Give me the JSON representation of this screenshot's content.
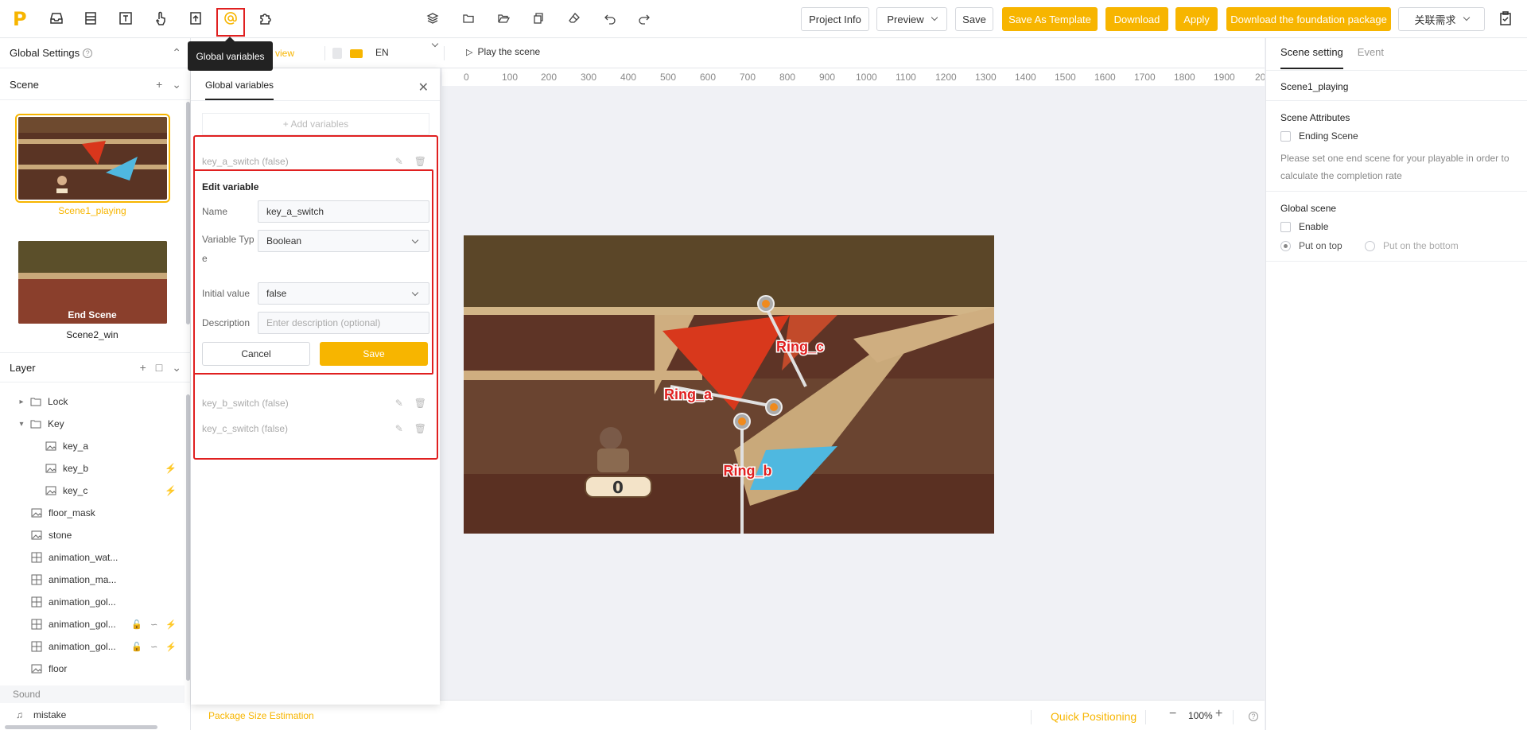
{
  "toolbar": {
    "logo": "P",
    "tooltip": "Global variables",
    "project_info": "Project Info",
    "preview": "Preview",
    "save": "Save",
    "save_as_template": "Save As Template",
    "download": "Download",
    "apply": "Apply",
    "download_foundation": "Download the foundation package",
    "related_needs": "关联需求"
  },
  "subbar": {
    "view_label": "view",
    "language": "EN",
    "play_scene": "Play the scene"
  },
  "ruler": [
    "0",
    "100",
    "200",
    "300",
    "400",
    "500",
    "600",
    "700",
    "800",
    "900",
    "1000",
    "1100",
    "1200",
    "1300",
    "1400",
    "1500",
    "1600",
    "1700",
    "1800",
    "1900",
    "20"
  ],
  "left": {
    "global_settings": "Global Settings",
    "scene_title": "Scene",
    "scenes": [
      {
        "name": "Scene1_playing"
      },
      {
        "name": "Scene2_win",
        "overlay": "End Scene"
      }
    ],
    "layer_title": "Layer",
    "layers": [
      {
        "name": "Lock"
      },
      {
        "name": "Key"
      },
      {
        "name": "key_a"
      },
      {
        "name": "key_b"
      },
      {
        "name": "key_c"
      },
      {
        "name": "floor_mask"
      },
      {
        "name": "stone"
      },
      {
        "name": "animation_wat..."
      },
      {
        "name": "animation_ma..."
      },
      {
        "name": "animation_gol..."
      },
      {
        "name": "animation_gol..."
      },
      {
        "name": "animation_gol..."
      },
      {
        "name": "floor"
      }
    ],
    "sound_title": "Sound",
    "sound_item": "mistake"
  },
  "global_vars": {
    "tab": "Global variables",
    "add": "+ Add variables",
    "vars": [
      {
        "label": "key_a_switch (false)"
      },
      {
        "label": "key_b_switch (false)"
      },
      {
        "label": "key_c_switch (false)"
      }
    ],
    "edit_title": "Edit variable",
    "name_label": "Name",
    "name_value": "key_a_switch",
    "type_label_1": "Variable Typ",
    "type_label_2": "e",
    "type_value": "Boolean",
    "initial_label": "Initial value",
    "initial_value": "false",
    "desc_label": "Description",
    "desc_placeholder": "Enter description (optional)",
    "cancel": "Cancel",
    "save": "Save"
  },
  "stage": {
    "ring_a": "Ring_a",
    "ring_b": "Ring_b",
    "ring_c": "Ring_c",
    "score": "0"
  },
  "right": {
    "tab_scene": "Scene setting",
    "tab_event": "Event",
    "scene_name": "Scene1_playing",
    "attributes_title": "Scene Attributes",
    "ending_scene": "Ending Scene",
    "hint": "Please set one end scene for your playable in order to calculate the completion rate",
    "global_scene_title": "Global scene",
    "enable": "Enable",
    "put_top": "Put on top",
    "put_bottom": "Put on the bottom"
  },
  "bottom": {
    "package_size": "Package Size Estimation",
    "quick_positioning": "Quick Positioning",
    "zoom": "100%"
  },
  "colors": {
    "accent": "#f7b500",
    "highlight": "#e02020"
  }
}
